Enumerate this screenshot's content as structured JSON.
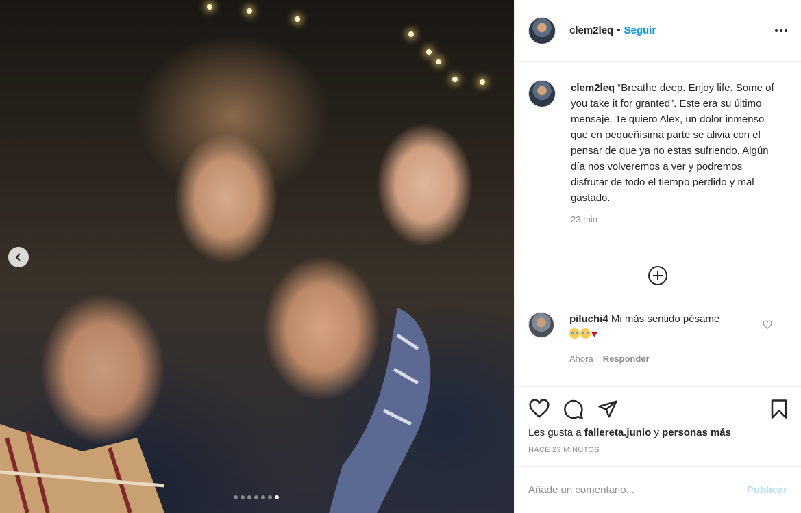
{
  "post": {
    "author": "clem2leq",
    "separator": "•",
    "follow_label": "Seguir",
    "more_icon": "more-options-icon"
  },
  "photo": {
    "carousel_total": 7,
    "carousel_active_index": 7
  },
  "caption": {
    "username": "clem2leq",
    "text": "“Breathe deep. Enjoy life. Some of you take it for granted”. Este era su último mensaje. Te quiero Alex, un dolor inmenso que en pequeñísima parte se alivia con el pensar de que ya no estas sufriendo. Algún día nos volveremos a ver y podremos disfrutar de todo el tiempo perdido y mal gastado.",
    "time": "23 min"
  },
  "comment": {
    "username": "piluchi4",
    "text": "Mi más sentido pésame",
    "time": "Ahora",
    "reply_label": "Responder"
  },
  "actions": {
    "icons": [
      "heart-icon",
      "comment-icon",
      "share-icon",
      "bookmark-icon"
    ]
  },
  "likes": {
    "prefix": "Les gusta a",
    "user": "fallereta.junio",
    "suffix": "y",
    "rest": "personas más"
  },
  "posted_time": "HACE 23 MINUTOS",
  "add_comment": {
    "placeholder": "Añade un comentario...",
    "publish_label": "Publicar"
  },
  "colors": {
    "link_blue": "#0095f6",
    "publish_disabled": "#b2dffc",
    "muted": "#8e8e8e",
    "text": "#262626"
  }
}
